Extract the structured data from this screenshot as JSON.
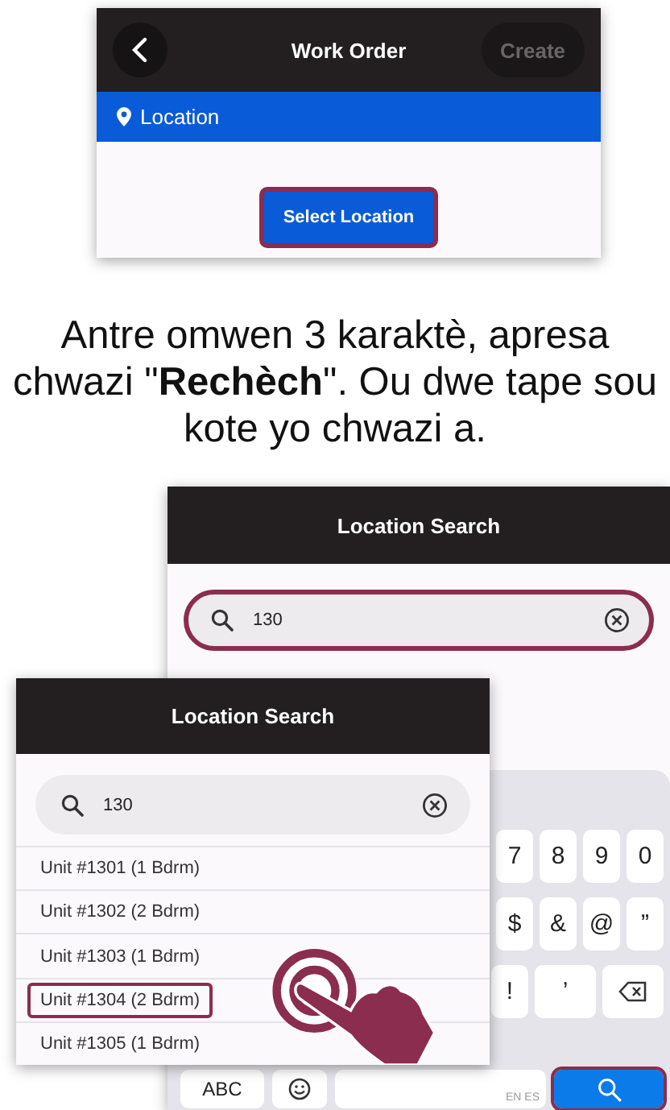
{
  "work_order_screen": {
    "title": "Work Order",
    "create_button": {
      "label": "Create",
      "disabled": true
    },
    "section": {
      "label": "Location"
    },
    "select_button": {
      "label": "Select Location",
      "highlighted": true
    }
  },
  "instruction": "Antre omwen 3 karaktè, apresa chwazi \"**Rechèch**\". Ou dwe tape sou kote yo chwazi a.",
  "search_screen": {
    "title": "Location Search",
    "search": {
      "value": "130",
      "highlighted": true
    },
    "keyboard": {
      "rows": [
        {
          "keys": [
            {
              "kind": "char",
              "label": "7"
            },
            {
              "kind": "char",
              "label": "8"
            },
            {
              "kind": "char",
              "label": "9"
            },
            {
              "kind": "char",
              "label": "0"
            }
          ]
        },
        {
          "keys": [
            {
              "kind": "char",
              "label": "$"
            },
            {
              "kind": "char",
              "label": "&"
            },
            {
              "kind": "char",
              "label": "@"
            },
            {
              "kind": "char",
              "label": "”"
            }
          ]
        },
        {
          "keys": [
            {
              "kind": "char",
              "label": "!"
            },
            {
              "kind": "wide",
              "label": "’"
            },
            {
              "kind": "backspace"
            }
          ]
        },
        {
          "keys": [
            {
              "kind": "mode",
              "label": "ABC"
            },
            {
              "kind": "emoji"
            },
            {
              "kind": "space",
              "label": "EN ES"
            },
            {
              "kind": "search",
              "highlighted": true
            }
          ]
        }
      ]
    }
  },
  "results_screen": {
    "title": "Location Search",
    "search": {
      "value": "130"
    },
    "results": [
      {
        "label": "Unit #1301 (1 Bdrm)",
        "selected": false
      },
      {
        "label": "Unit #1302 (2 Bdrm)",
        "selected": false
      },
      {
        "label": "Unit #1303 (1 Bdrm)",
        "selected": false
      },
      {
        "label": "Unit #1304 (2 Bdrm)",
        "selected": true
      },
      {
        "label": "Unit #1305 (1 Bdrm)",
        "selected": false
      }
    ]
  }
}
